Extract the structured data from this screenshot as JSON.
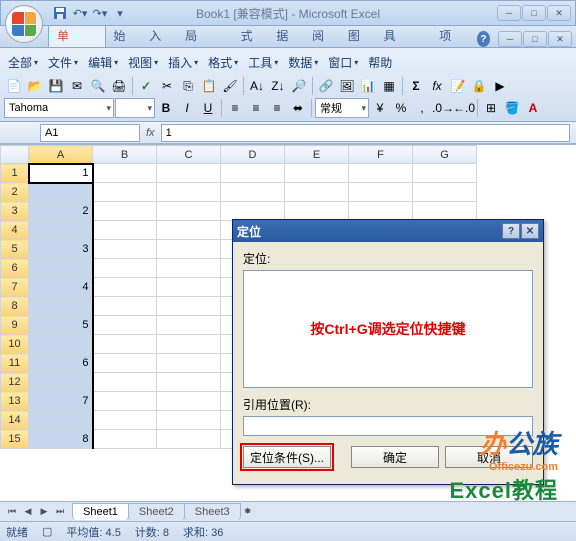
{
  "title": "Book1  [兼容模式] - Microsoft Excel",
  "ribbon": {
    "tabs": [
      "经典菜单",
      "开始",
      "插入",
      "页面布局",
      "公式",
      "数据",
      "审阅",
      "视图",
      "开发工具",
      "加载项"
    ],
    "active": 0,
    "menus": [
      "全部",
      "文件",
      "编辑",
      "视图",
      "插入",
      "格式",
      "工具",
      "数据",
      "窗口",
      "帮助"
    ]
  },
  "font": {
    "name": "Tahoma",
    "style_label": "常规"
  },
  "namebox": "A1",
  "formula": "1",
  "columns": [
    "A",
    "B",
    "C",
    "D",
    "E",
    "F",
    "G"
  ],
  "rows_count": 15,
  "colA": {
    "1": "1",
    "2": "",
    "3": "2",
    "4": "",
    "5": "3",
    "6": "",
    "7": "4",
    "8": "",
    "9": "5",
    "10": "",
    "11": "6",
    "12": "",
    "13": "7",
    "14": "",
    "15": "8"
  },
  "dialog": {
    "title": "定位",
    "list_label": "定位:",
    "hint": "按Ctrl+G调选定位快捷键",
    "ref_label": "引用位置(R):",
    "btn_special": "定位条件(S)...",
    "btn_ok": "确定",
    "btn_cancel": "取消"
  },
  "sheets": [
    "Sheet1",
    "Sheet2",
    "Sheet3"
  ],
  "status": {
    "ready": "就绪",
    "avg": "平均值: 4.5",
    "count": "计数: 8",
    "sum": "求和: 36"
  },
  "watermark": {
    "brand": "办公族",
    "url": "Officezu.com",
    "sub": "Excel教程"
  }
}
